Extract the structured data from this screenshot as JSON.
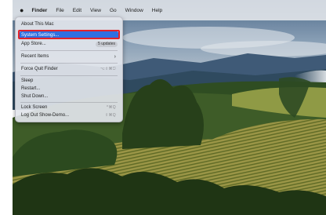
{
  "menubar": {
    "apple_icon": "apple-logo-icon",
    "app_name": "Finder",
    "items": [
      "File",
      "Edit",
      "View",
      "Go",
      "Window",
      "Help"
    ]
  },
  "apple_menu": {
    "about": "About This Mac",
    "system_settings": "System Settings...",
    "app_store": "App Store...",
    "app_store_badge": "5 updates",
    "recent_items": "Recent Items",
    "recent_items_arrow": "›",
    "force_quit": "Force Quit Finder",
    "force_quit_shortcut": "⌥⇧⌘⎋",
    "sleep": "Sleep",
    "restart": "Restart...",
    "shut_down": "Shut Down...",
    "lock_screen": "Lock Screen",
    "lock_screen_shortcut": "^⌘Q",
    "log_out": "Log Out Show-Demo...",
    "log_out_shortcut": "⇧⌘Q"
  },
  "colors": {
    "highlight": "#2f6fe0",
    "annotation_box": "#e2222a"
  }
}
